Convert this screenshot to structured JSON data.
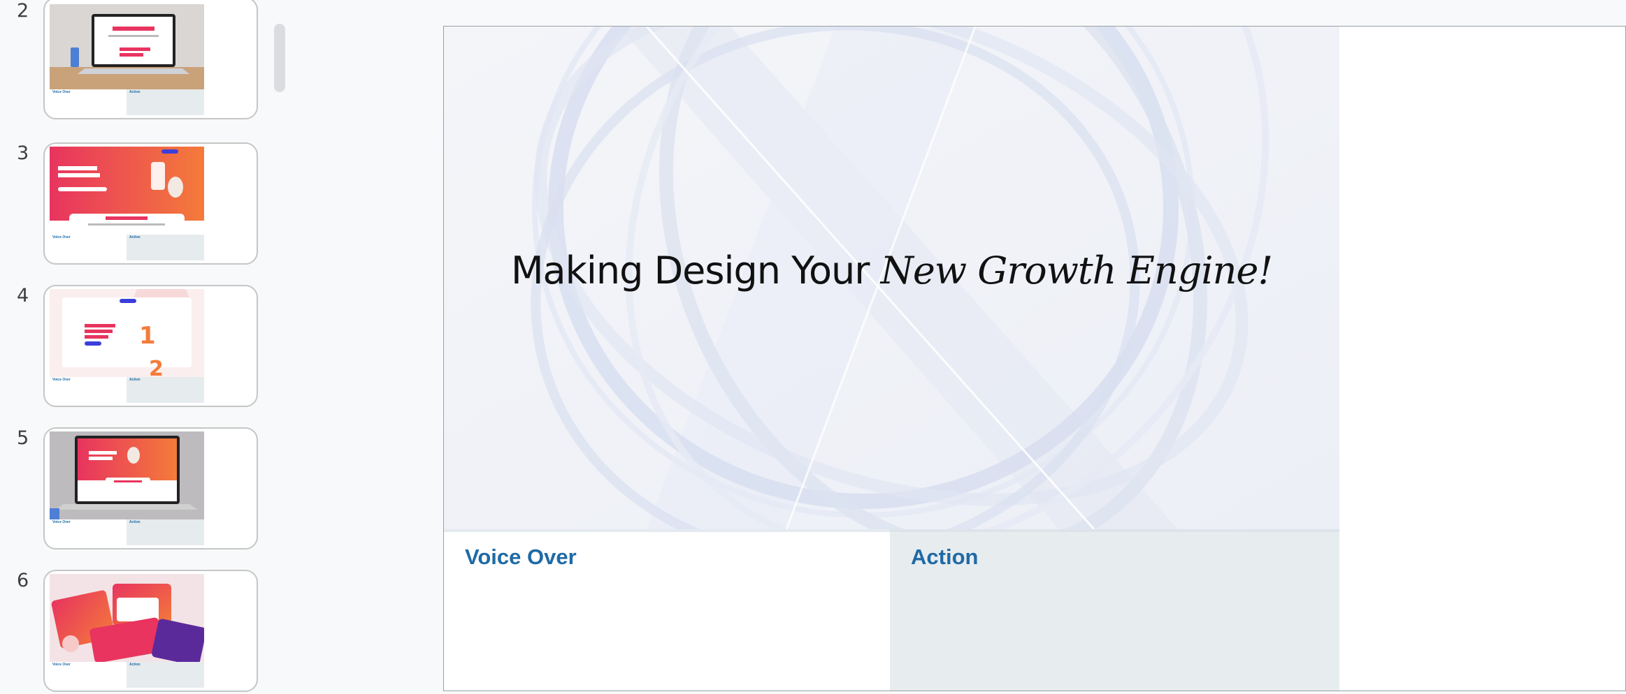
{
  "filmstrip": {
    "slides": [
      {
        "number": "2",
        "voice_label": "Voice Over",
        "action_label": "Action"
      },
      {
        "number": "3",
        "voice_label": "Voice Over",
        "action_label": "Action"
      },
      {
        "number": "4",
        "voice_label": "Voice Over",
        "action_label": "Action"
      },
      {
        "number": "5",
        "voice_label": "Voice Over",
        "action_label": "Action"
      },
      {
        "number": "6",
        "voice_label": "Voice Over",
        "action_label": "Action"
      }
    ]
  },
  "slide": {
    "headline_plain": "Making Design Your ",
    "headline_italic": "New Growth Engine!",
    "voice_over_label": "Voice Over",
    "action_label": "Action"
  },
  "colors": {
    "label_blue": "#1f6aa5",
    "action_panel": "#e7ecef",
    "thumb_orange": "#f26b3a",
    "thumb_pink": "#e8345f"
  }
}
